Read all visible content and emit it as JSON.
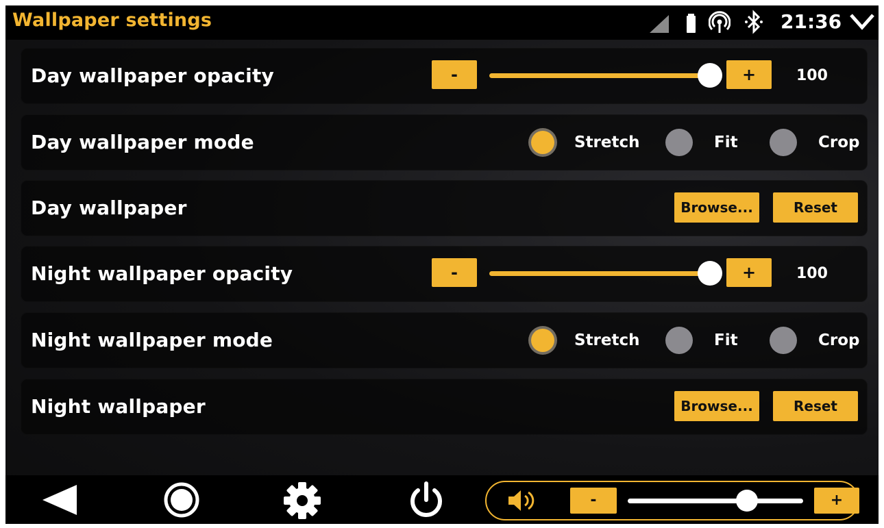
{
  "header": {
    "title": "Wallpaper settings",
    "clock": "21:36"
  },
  "rows": {
    "day_opacity": {
      "label": "Day wallpaper opacity",
      "minus": "-",
      "plus": "+",
      "value": "100",
      "level": 1.0
    },
    "day_mode": {
      "label": "Day wallpaper mode",
      "options": [
        "Stretch",
        "Fit",
        "Crop"
      ],
      "selected": "Stretch"
    },
    "day_wallpaper": {
      "label": "Day wallpaper",
      "browse": "Browse...",
      "reset": "Reset"
    },
    "night_opacity": {
      "label": "Night wallpaper opacity",
      "minus": "-",
      "plus": "+",
      "value": "100",
      "level": 1.0
    },
    "night_mode": {
      "label": "Night wallpaper mode",
      "options": [
        "Stretch",
        "Fit",
        "Crop"
      ],
      "selected": "Stretch"
    },
    "night_wallpaper": {
      "label": "Night wallpaper",
      "browse": "Browse...",
      "reset": "Reset"
    }
  },
  "bottom": {
    "icons": [
      "back-icon",
      "home-icon",
      "settings-gear-icon",
      "power-icon",
      "speaker-icon"
    ],
    "volume": {
      "minus": "-",
      "plus": "+",
      "level": 0.68
    }
  },
  "colors": {
    "accent": "#f2b531",
    "background": "#141416",
    "radio_off": "#8b8a8f"
  }
}
